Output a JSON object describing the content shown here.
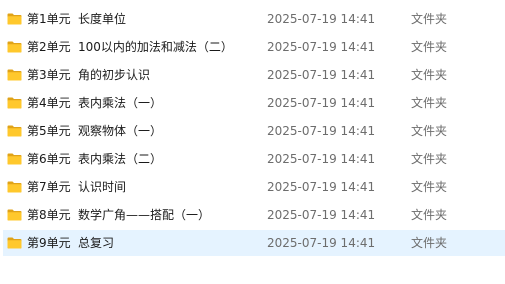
{
  "colors": {
    "folder_back": "#e0a318",
    "folder_front": "#ffc82c",
    "selected_row_bg": "#e5f3ff",
    "name_text": "#1a1a1a",
    "meta_text": "#6d6d6d"
  },
  "files": [
    {
      "unit": "第1单元",
      "title": "长度单位",
      "date": "2025-07-19 14:41",
      "type": "文件夹",
      "icon": "folder-icon"
    },
    {
      "unit": "第2单元",
      "title": "100以内的加法和减法（二）",
      "date": "2025-07-19 14:41",
      "type": "文件夹",
      "icon": "folder-icon"
    },
    {
      "unit": "第3单元",
      "title": "角的初步认识",
      "date": "2025-07-19 14:41",
      "type": "文件夹",
      "icon": "folder-icon"
    },
    {
      "unit": "第4单元",
      "title": "表内乘法（一）",
      "date": "2025-07-19 14:41",
      "type": "文件夹",
      "icon": "folder-icon"
    },
    {
      "unit": "第5单元",
      "title": "观察物体（一）",
      "date": "2025-07-19 14:41",
      "type": "文件夹",
      "icon": "folder-icon"
    },
    {
      "unit": "第6单元",
      "title": "表内乘法（二）",
      "date": "2025-07-19 14:41",
      "type": "文件夹",
      "icon": "folder-icon"
    },
    {
      "unit": "第7单元",
      "title": "认识时间",
      "date": "2025-07-19 14:41",
      "type": "文件夹",
      "icon": "folder-icon"
    },
    {
      "unit": "第8单元",
      "title": "数学广角——搭配（一）",
      "date": "2025-07-19 14:41",
      "type": "文件夹",
      "icon": "folder-icon"
    },
    {
      "unit": "第9单元",
      "title": "总复习",
      "date": "2025-07-19 14:41",
      "type": "文件夹",
      "icon": "folder-icon",
      "selected": true
    }
  ]
}
